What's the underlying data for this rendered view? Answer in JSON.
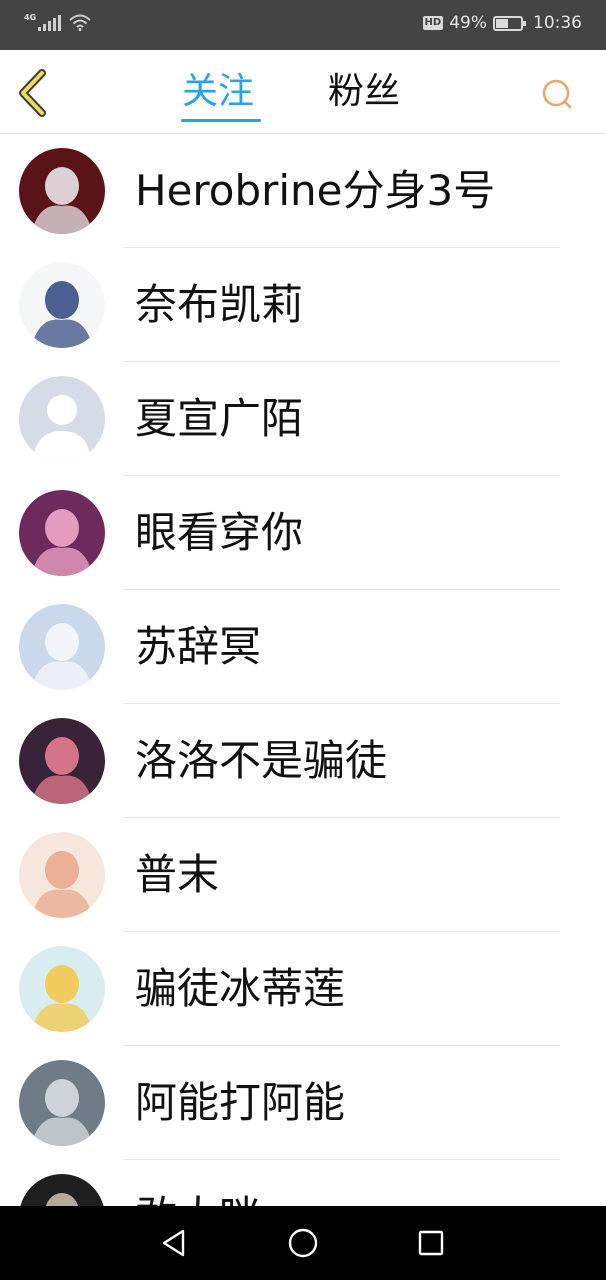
{
  "status_bar": {
    "network": "4G",
    "hd_badge": "HD",
    "battery": "49%",
    "battery_level": 0.49,
    "time": "10:36"
  },
  "header": {
    "tabs": [
      {
        "label": "关注",
        "active": true
      },
      {
        "label": "粉丝",
        "active": false
      }
    ],
    "accent_color": "#2aa2e8",
    "back_icon": "chevron-left-icon",
    "search_icon": "search-icon"
  },
  "users": [
    {
      "name": "Herobrine分身3号",
      "avatar_colors": [
        "#5a1418",
        "#e8e4ea"
      ]
    },
    {
      "name": "奈布凯莉",
      "avatar_colors": [
        "#f4f6f8",
        "#3a4f86"
      ]
    },
    {
      "name": "夏宣广陌",
      "avatar_colors": [
        "#d5dbe7",
        "#ffffff"
      ]
    },
    {
      "name": "眼看穿你",
      "avatar_colors": [
        "#6e2a5c",
        "#f1a7c9"
      ]
    },
    {
      "name": "苏辞冥",
      "avatar_colors": [
        "#c9d8ea",
        "#f5f8fc"
      ]
    },
    {
      "name": "洛洛不是骗徒",
      "avatar_colors": [
        "#3a2238",
        "#e77c92"
      ]
    },
    {
      "name": "普末",
      "avatar_colors": [
        "#f6e6dc",
        "#e9a88d"
      ]
    },
    {
      "name": "骗徒冰蒂莲",
      "avatar_colors": [
        "#d9ecef",
        "#f2c94c"
      ]
    },
    {
      "name": "阿能打阿能",
      "avatar_colors": [
        "#6f7b86",
        "#d7dde2"
      ]
    },
    {
      "name": "敢大咪",
      "avatar_colors": [
        "#1f1f1f",
        "#c8b8a8"
      ]
    }
  ],
  "bottom_nav": {
    "back": "triangle-back-icon",
    "home": "circle-home-icon",
    "recents": "square-recents-icon"
  }
}
